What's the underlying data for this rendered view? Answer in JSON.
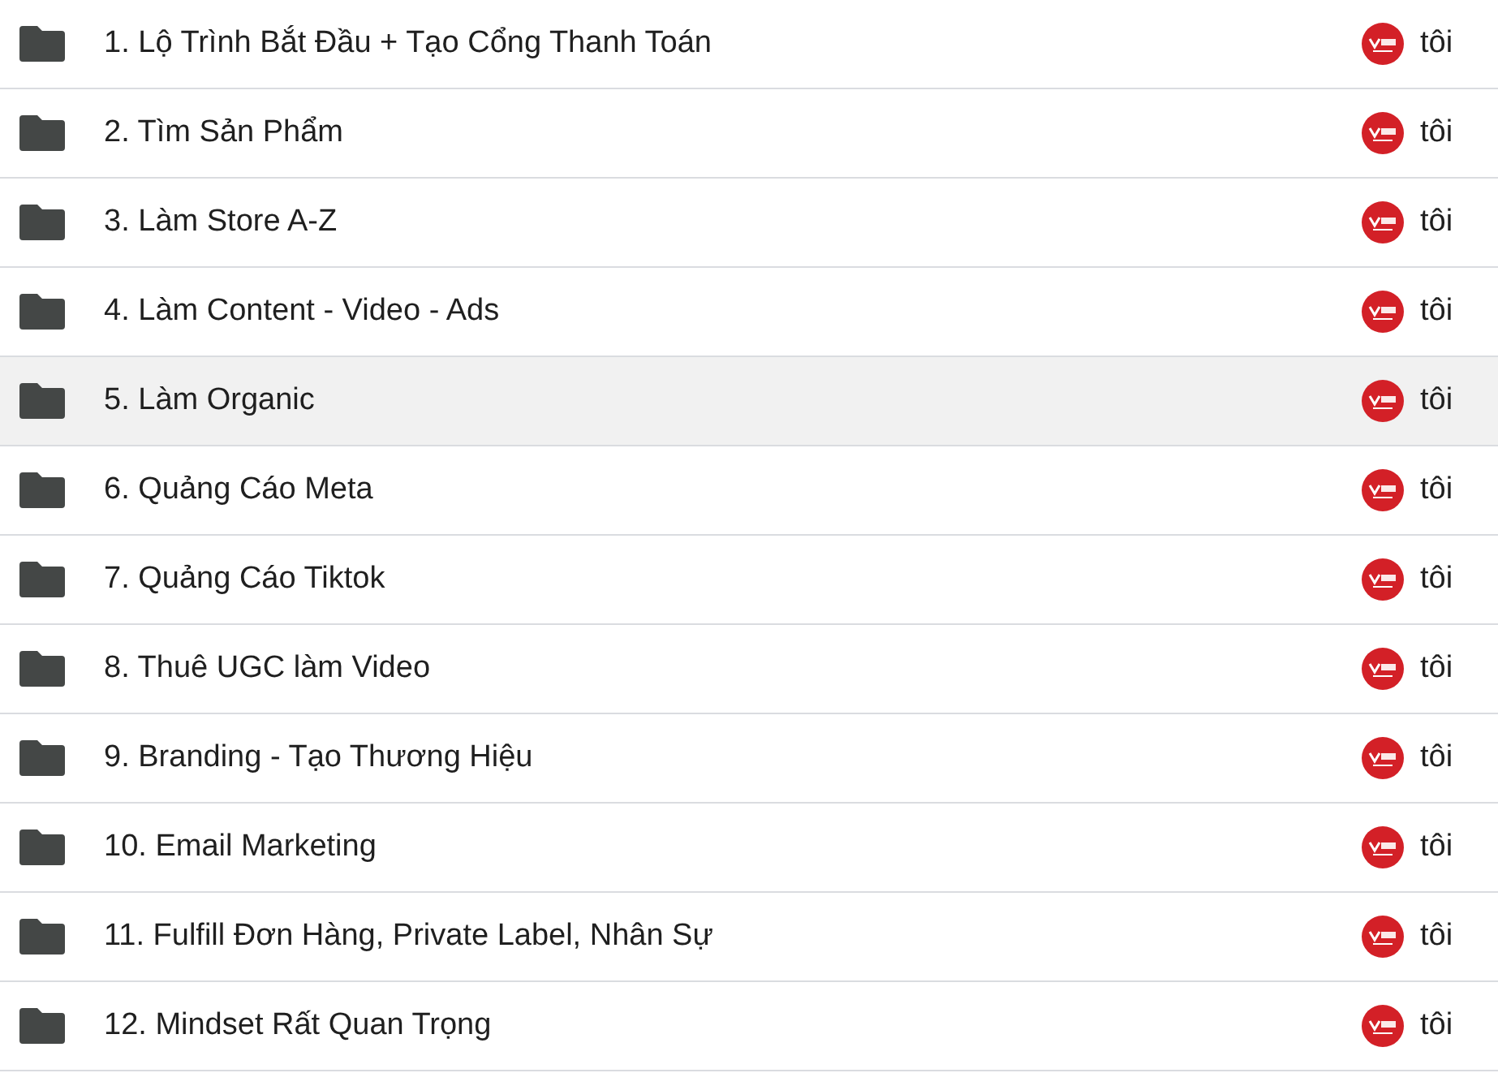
{
  "rows": [
    {
      "name": "1. Lộ Trình Bắt Đầu + Tạo Cổng Thanh Toán",
      "owner": "tôi",
      "highlighted": false
    },
    {
      "name": "2. Tìm Sản Phẩm",
      "owner": "tôi",
      "highlighted": false
    },
    {
      "name": "3. Làm Store A-Z",
      "owner": "tôi",
      "highlighted": false
    },
    {
      "name": "4. Làm Content - Video - Ads",
      "owner": "tôi",
      "highlighted": false
    },
    {
      "name": "5. Làm Organic",
      "owner": "tôi",
      "highlighted": true
    },
    {
      "name": "6. Quảng Cáo Meta",
      "owner": "tôi",
      "highlighted": false
    },
    {
      "name": "7. Quảng Cáo Tiktok",
      "owner": "tôi",
      "highlighted": false
    },
    {
      "name": "8. Thuê UGC làm Video",
      "owner": "tôi",
      "highlighted": false
    },
    {
      "name": "9. Branding - Tạo Thương Hiệu",
      "owner": "tôi",
      "highlighted": false
    },
    {
      "name": "10. Email Marketing",
      "owner": "tôi",
      "highlighted": false
    },
    {
      "name": "11. Fulfill Đơn Hàng, Private Label, Nhân Sự",
      "owner": "tôi",
      "highlighted": false
    },
    {
      "name": "12. Mindset Rất Quan Trọng",
      "owner": "tôi",
      "highlighted": false
    }
  ]
}
